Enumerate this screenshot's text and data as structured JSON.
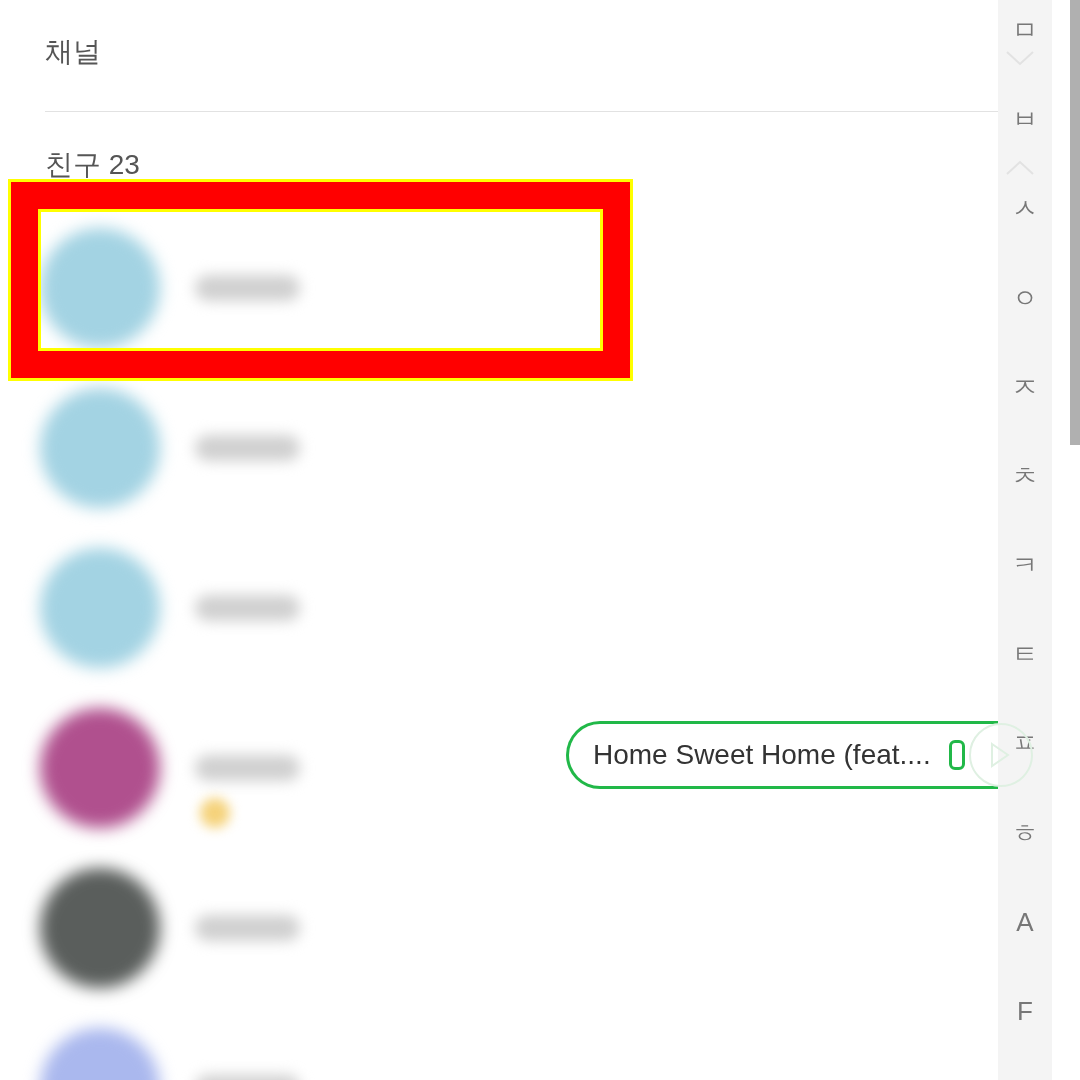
{
  "channel_section": {
    "title": "채널"
  },
  "friends_section": {
    "title": "친구 23",
    "friends": [
      {
        "color": "#a3d3e3",
        "status_shown": false
      },
      {
        "color": "#a3d3e3",
        "status_shown": false
      },
      {
        "color": "#a3d3e3",
        "status_shown": false
      },
      {
        "color": "#b0508e",
        "status_shown": true
      },
      {
        "color": "#5a5e5c",
        "status_shown": false
      },
      {
        "color": "#aab8ee",
        "status_shown": false
      }
    ]
  },
  "highlight": {
    "shown": true
  },
  "now_playing": {
    "title": "Home Sweet Home (feat...."
  },
  "index_bar": {
    "letters": [
      "ㅁ",
      "ㅂ",
      "ㅅ",
      "ㅇ",
      "ㅈ",
      "ㅊ",
      "ㅋ",
      "ㅌ",
      "ㅍ",
      "ㅎ",
      "A",
      "F"
    ]
  }
}
